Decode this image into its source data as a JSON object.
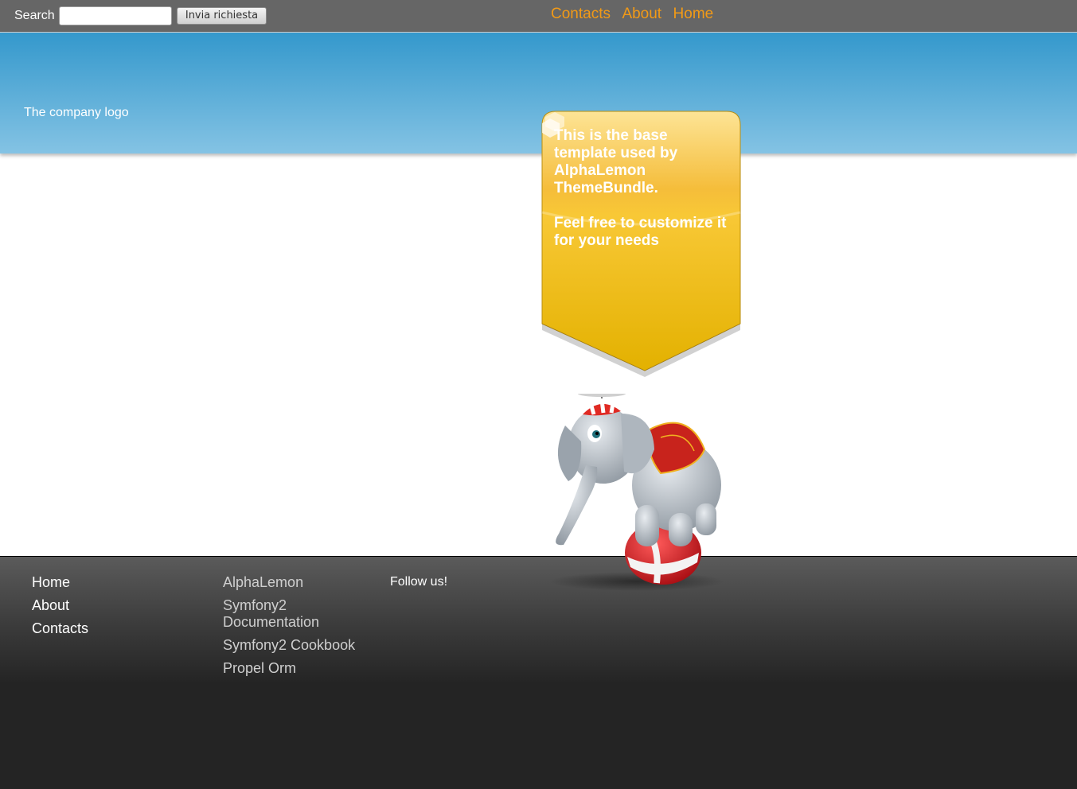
{
  "search": {
    "label": "Search",
    "value": "",
    "button": "Invia richiesta"
  },
  "topnav": [
    "Contacts",
    "About",
    "Home"
  ],
  "header": {
    "logo_text": "The company logo"
  },
  "banner": {
    "text_1": "This is the base template used by AlphaLemon ThemeBundle.",
    "text_2": "Feel free to customize it for your needs",
    "icon": "cube-icon"
  },
  "illustration": {
    "icon": "elephant-on-ball-illustration"
  },
  "footer": {
    "col1": [
      "Home",
      "About",
      "Contacts"
    ],
    "col2": [
      "AlphaLemon",
      "Symfony2 Documentation",
      "Symfony2 Cookbook",
      "Propel Orm"
    ],
    "follow": "Follow us!"
  },
  "colors": {
    "nav_link": "#f29a16",
    "topbar": "#666666",
    "header_top": "#3498cc",
    "banner": "#f5c32a"
  }
}
